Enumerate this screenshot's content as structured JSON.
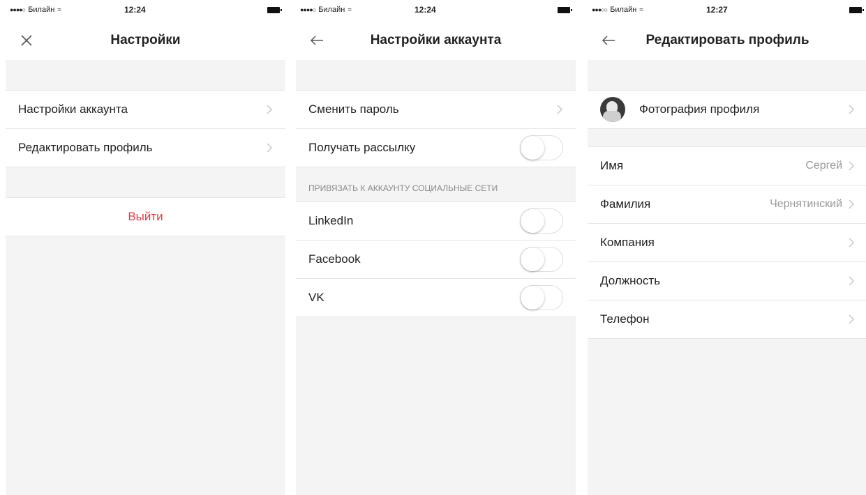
{
  "screens": [
    {
      "status": {
        "carrier": "Билайн",
        "signal": "●●●●○",
        "time": "12:24"
      },
      "title": "Настройки",
      "nav_icon": "close-icon",
      "items": [
        {
          "label": "Настройки аккаунта"
        },
        {
          "label": "Редактировать профиль"
        }
      ],
      "logout_label": "Выйти"
    },
    {
      "status": {
        "carrier": "Билайн",
        "signal": "●●●●○",
        "time": "12:24"
      },
      "title": "Настройки аккаунта",
      "nav_icon": "back-arrow-icon",
      "items": [
        {
          "label": "Сменить пароль"
        },
        {
          "label": "Получать рассылку",
          "toggle_on": false
        }
      ],
      "section_header": "ПРИВЯЗАТЬ К АККАУНТУ СОЦИАЛЬНЫЕ СЕТИ",
      "social": [
        {
          "label": "LinkedIn",
          "toggle_on": false
        },
        {
          "label": "Facebook",
          "toggle_on": false
        },
        {
          "label": "VK",
          "toggle_on": false
        }
      ]
    },
    {
      "status": {
        "carrier": "Билайн",
        "signal": "●●●○○",
        "time": "12:27"
      },
      "title": "Редактировать профиль",
      "nav_icon": "back-arrow-icon",
      "photo_label": "Фотография профиля",
      "fields": [
        {
          "label": "Имя",
          "value": "Сергей"
        },
        {
          "label": "Фамилия",
          "value": "Чернятинский"
        },
        {
          "label": "Компания",
          "value": ""
        },
        {
          "label": "Должность",
          "value": ""
        },
        {
          "label": "Телефон",
          "value": ""
        }
      ]
    }
  ],
  "colors": {
    "accent_red": "#e33b44",
    "background": "#f4f4f4",
    "text": "#222222",
    "secondary": "#999999"
  }
}
